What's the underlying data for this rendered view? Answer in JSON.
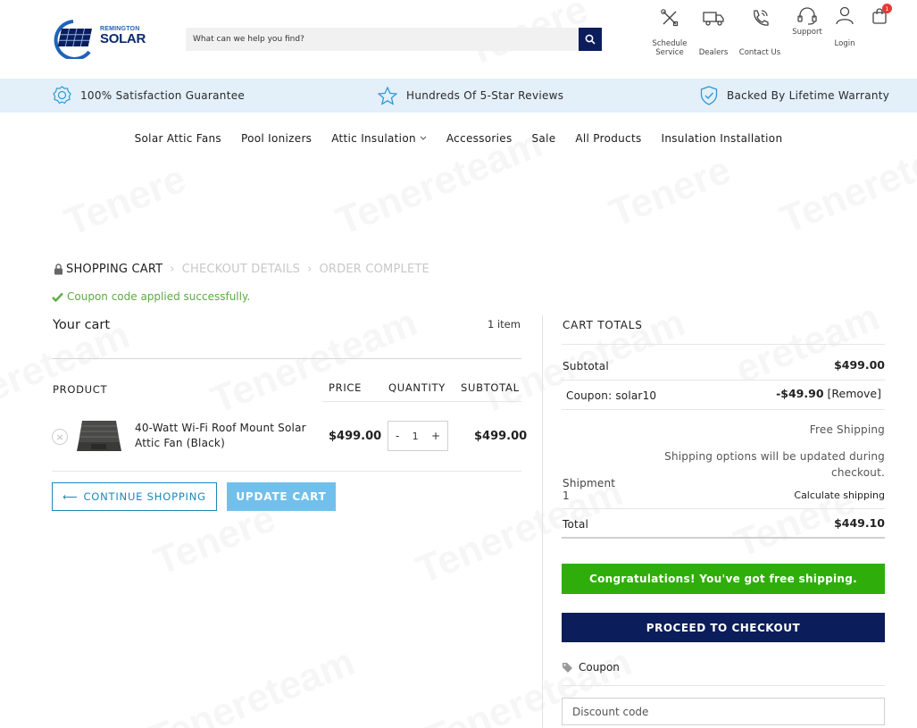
{
  "header": {
    "logo_top": "REMINGTON",
    "logo_bottom": "SOLAR",
    "search_placeholder": "What can we help you find?",
    "icons": [
      {
        "name": "schedule-service",
        "label_1": "Schedule",
        "label_2": "Service"
      },
      {
        "name": "dealers",
        "label_1": "Dealers"
      },
      {
        "name": "contact-us",
        "label_1": "Contact Us"
      },
      {
        "name": "support",
        "label_1": "Support"
      },
      {
        "name": "login",
        "label_1": "Login"
      }
    ],
    "cart_count": "1"
  },
  "benefits": [
    {
      "label": "100% Satisfaction Guarantee"
    },
    {
      "label": "Hundreds Of 5-Star Reviews"
    },
    {
      "label": "Backed By Lifetime Warranty"
    }
  ],
  "nav": [
    {
      "label": "Solar Attic Fans"
    },
    {
      "label": "Pool Ionizers"
    },
    {
      "label": "Attic Insulation"
    },
    {
      "label": "Accessories"
    },
    {
      "label": "Sale"
    },
    {
      "label": "All Products"
    },
    {
      "label": "Insulation Installation"
    }
  ],
  "breadcrumb": {
    "step1": "SHOPPING CART",
    "step2": "CHECKOUT DETAILS",
    "step3": "ORDER COMPLETE"
  },
  "notice": "Coupon code applied successfully.",
  "cart": {
    "title": "Your cart",
    "item_count": "1 item",
    "headers": {
      "product": "PRODUCT",
      "price": "PRICE",
      "quantity": "QUANTITY",
      "subtotal": "SUBTOTAL"
    },
    "items": [
      {
        "name": "40-Watt Wi-Fi Roof Mount Solar Attic Fan (Black)",
        "price": "$499.00",
        "qty": "1",
        "subtotal": "$499.00"
      }
    ],
    "qty_minus": "-",
    "qty_plus": "+",
    "continue_label": "CONTINUE SHOPPING",
    "update_label": "UPDATE CART"
  },
  "totals": {
    "title": "CART TOTALS",
    "subtotal_label": "Subtotal",
    "subtotal_value": "$499.00",
    "coupon_label": "Coupon: solar10",
    "coupon_value": "-$49.90",
    "coupon_remove": "[Remove]",
    "shipping_method": "Free Shipping",
    "shipping_note_1": "Shipping options will be updated during",
    "shipping_note_2": "checkout.",
    "shipment_label": "Shipment",
    "shipment_num": "1",
    "calc_shipping": "Calculate shipping",
    "total_label": "Total",
    "total_value": "$449.10",
    "free_ship_msg": "Congratulations! You've got free shipping.",
    "checkout_label": "PROCEED TO CHECKOUT",
    "coupon_head": "Coupon",
    "coupon_placeholder": "Discount code"
  },
  "colors": {
    "navy": "#0b1d5a",
    "strip_bg": "#e3eff9",
    "success_green": "#2fae0b",
    "notice_green": "#5cab44",
    "accent_blue": "#1b88b8",
    "update_btn": "#71c0eb",
    "badge_red": "#e53935"
  }
}
